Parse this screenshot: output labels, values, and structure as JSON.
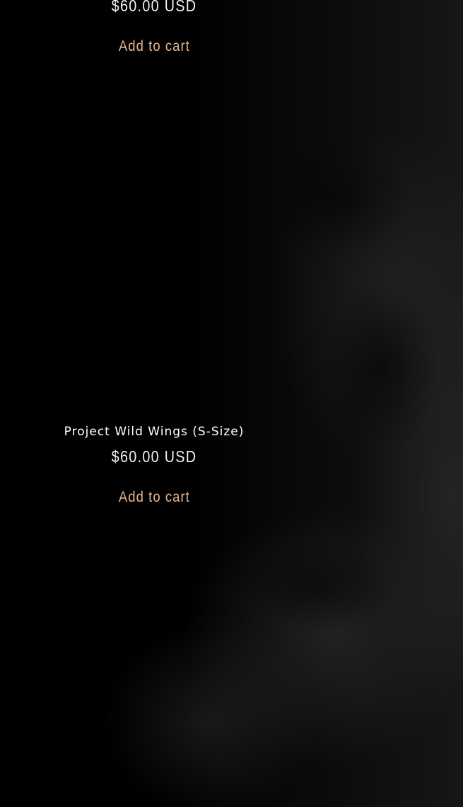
{
  "products": [
    {
      "name": "",
      "price": "$60.00 USD",
      "cta": "Add to cart"
    },
    {
      "name": "Project Wild Wings (S-Size)",
      "price": "$60.00 USD",
      "cta": "Add to cart"
    }
  ],
  "colors": {
    "background": "#000000",
    "text": "#ffffff",
    "accent": "#e7b38a"
  }
}
